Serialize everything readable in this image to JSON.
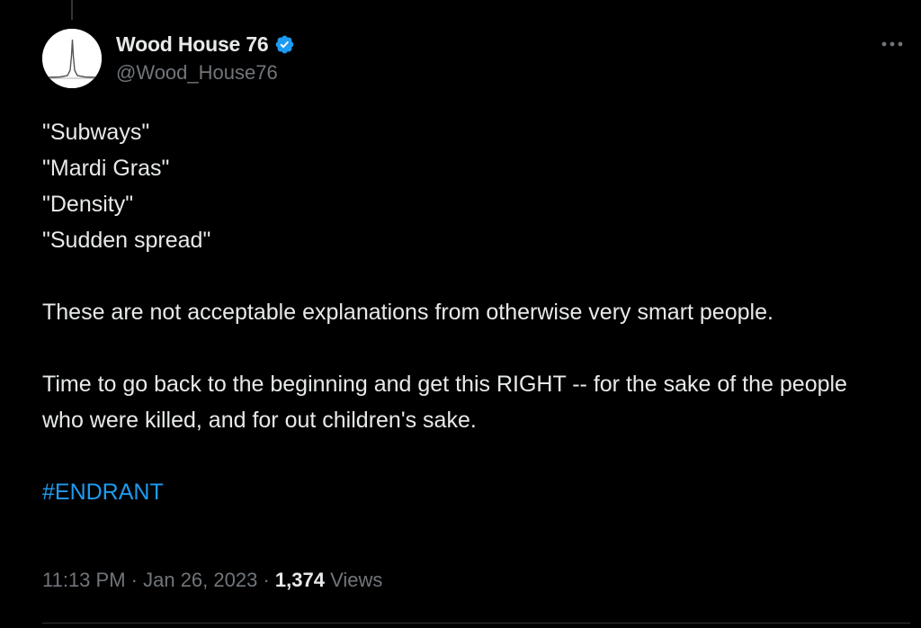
{
  "colors": {
    "background": "#000000",
    "text_primary": "#e7e9ea",
    "text_secondary": "#71767b",
    "accent": "#1d9bf0",
    "divider": "#2f3336"
  },
  "author": {
    "display_name": "Wood House 76",
    "handle": "@Wood_House76",
    "verified": true,
    "verified_icon": "verified-badge-icon",
    "avatar_icon": "single-peak-chart-avatar"
  },
  "more_icon": "more-horizontal-icon",
  "tweet": {
    "lines": [
      "\"Subways\"",
      "\"Mardi Gras\"",
      "\"Density\"",
      "\"Sudden spread\""
    ],
    "paragraph_1": "These are not acceptable explanations from otherwise very smart people.",
    "paragraph_2": "Time to go back to the beginning and get this RIGHT -- for the sake of the people who were killed, and for out children's sake.",
    "hashtag": "#ENDRANT"
  },
  "meta": {
    "time": "11:13 PM",
    "separator_1": " · ",
    "date": "Jan 26, 2023",
    "separator_2": " · ",
    "views_count": "1,374",
    "views_label": " Views"
  }
}
